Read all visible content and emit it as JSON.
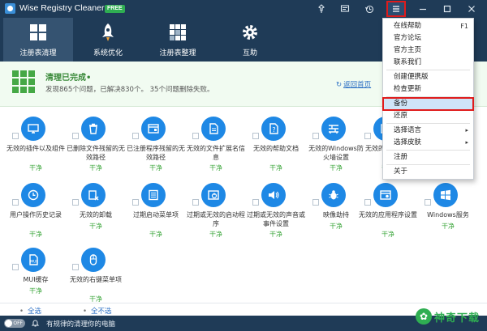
{
  "app": {
    "title": "Wise Registry Cleaner 9",
    "badge": "FREE"
  },
  "titlebar_buttons": [
    {
      "name": "pin-icon"
    },
    {
      "name": "feedback-icon"
    },
    {
      "name": "history-icon"
    },
    {
      "name": "menu-icon"
    },
    {
      "name": "minimize-icon"
    },
    {
      "name": "maximize-icon"
    },
    {
      "name": "close-icon"
    }
  ],
  "toolbar": {
    "items": [
      {
        "label": "注册表清理",
        "icon": "registry-clean-icon",
        "active": true
      },
      {
        "label": "系统优化",
        "icon": "rocket-icon",
        "active": false
      },
      {
        "label": "注册表整理",
        "icon": "defrag-icon",
        "active": false
      },
      {
        "label": "互助",
        "icon": "gear-icon",
        "active": false
      }
    ]
  },
  "status": {
    "title": "清理已完成•",
    "desc": "发现865个问题，已解决830个。 35个问题删除失败。",
    "back_link": "返回首页"
  },
  "items": [
    {
      "name": "无效的插件以及组件",
      "state": "干净",
      "icon": "monitor"
    },
    {
      "name": "已删除文件残留的无效路径",
      "state": "干净",
      "icon": "trash"
    },
    {
      "name": "已注册程序残留的无效路径",
      "state": "干净",
      "icon": "program"
    },
    {
      "name": "无效的文件扩展名信息",
      "state": "干净",
      "icon": "file"
    },
    {
      "name": "无效的帮助文档",
      "state": "干净",
      "icon": "help"
    },
    {
      "name": "无效的Windows防火墙设置",
      "state": "干净",
      "icon": "firewall"
    },
    {
      "name": "无效的开始菜单",
      "state": "干净",
      "icon": "startmenu"
    },
    {
      "name": "用户操作历史记录",
      "state": "干净",
      "icon": "clock"
    },
    {
      "name": "无效的卸载",
      "state": "干净",
      "icon": "uninstall"
    },
    {
      "name": "过期启动菜单项",
      "state": "干净",
      "icon": "menu"
    },
    {
      "name": "过期或无效的启动程序",
      "state": "干净",
      "icon": "startup"
    },
    {
      "name": "过期或无效的声音或事件设置",
      "state": "干净",
      "icon": "sound"
    },
    {
      "name": "映像劫持",
      "state": "干净",
      "icon": "bug"
    },
    {
      "name": "无效的应用程序设置",
      "state": "干净",
      "icon": "app"
    },
    {
      "name": "Windows服务",
      "state": "干净",
      "icon": "windows"
    },
    {
      "name": "MUI缓存",
      "state": "干净",
      "icon": "mui"
    },
    {
      "name": "无效的右键菜单项",
      "state": "干净",
      "icon": "mouse"
    }
  ],
  "footer": {
    "select_all": "全选",
    "select_none": "全不选"
  },
  "bottom": {
    "toggle": "OFF",
    "text": "有规律的清理你的电脑"
  },
  "menu": {
    "items": [
      {
        "label": "在线帮助",
        "shortcut": "F1"
      },
      {
        "label": "官方论坛"
      },
      {
        "label": "官方主页"
      },
      {
        "label": "联系我们"
      },
      {
        "label": "创建便携版"
      },
      {
        "label": "检查更新"
      },
      {
        "label": "备份",
        "highlighted": true
      },
      {
        "label": "还原"
      },
      {
        "label": "选择语言",
        "submenu": "▸"
      },
      {
        "label": "选择皮肤",
        "submenu": "▸"
      },
      {
        "label": "注册"
      },
      {
        "label": "关于"
      }
    ]
  },
  "watermark": {
    "text": "神奇下载"
  }
}
